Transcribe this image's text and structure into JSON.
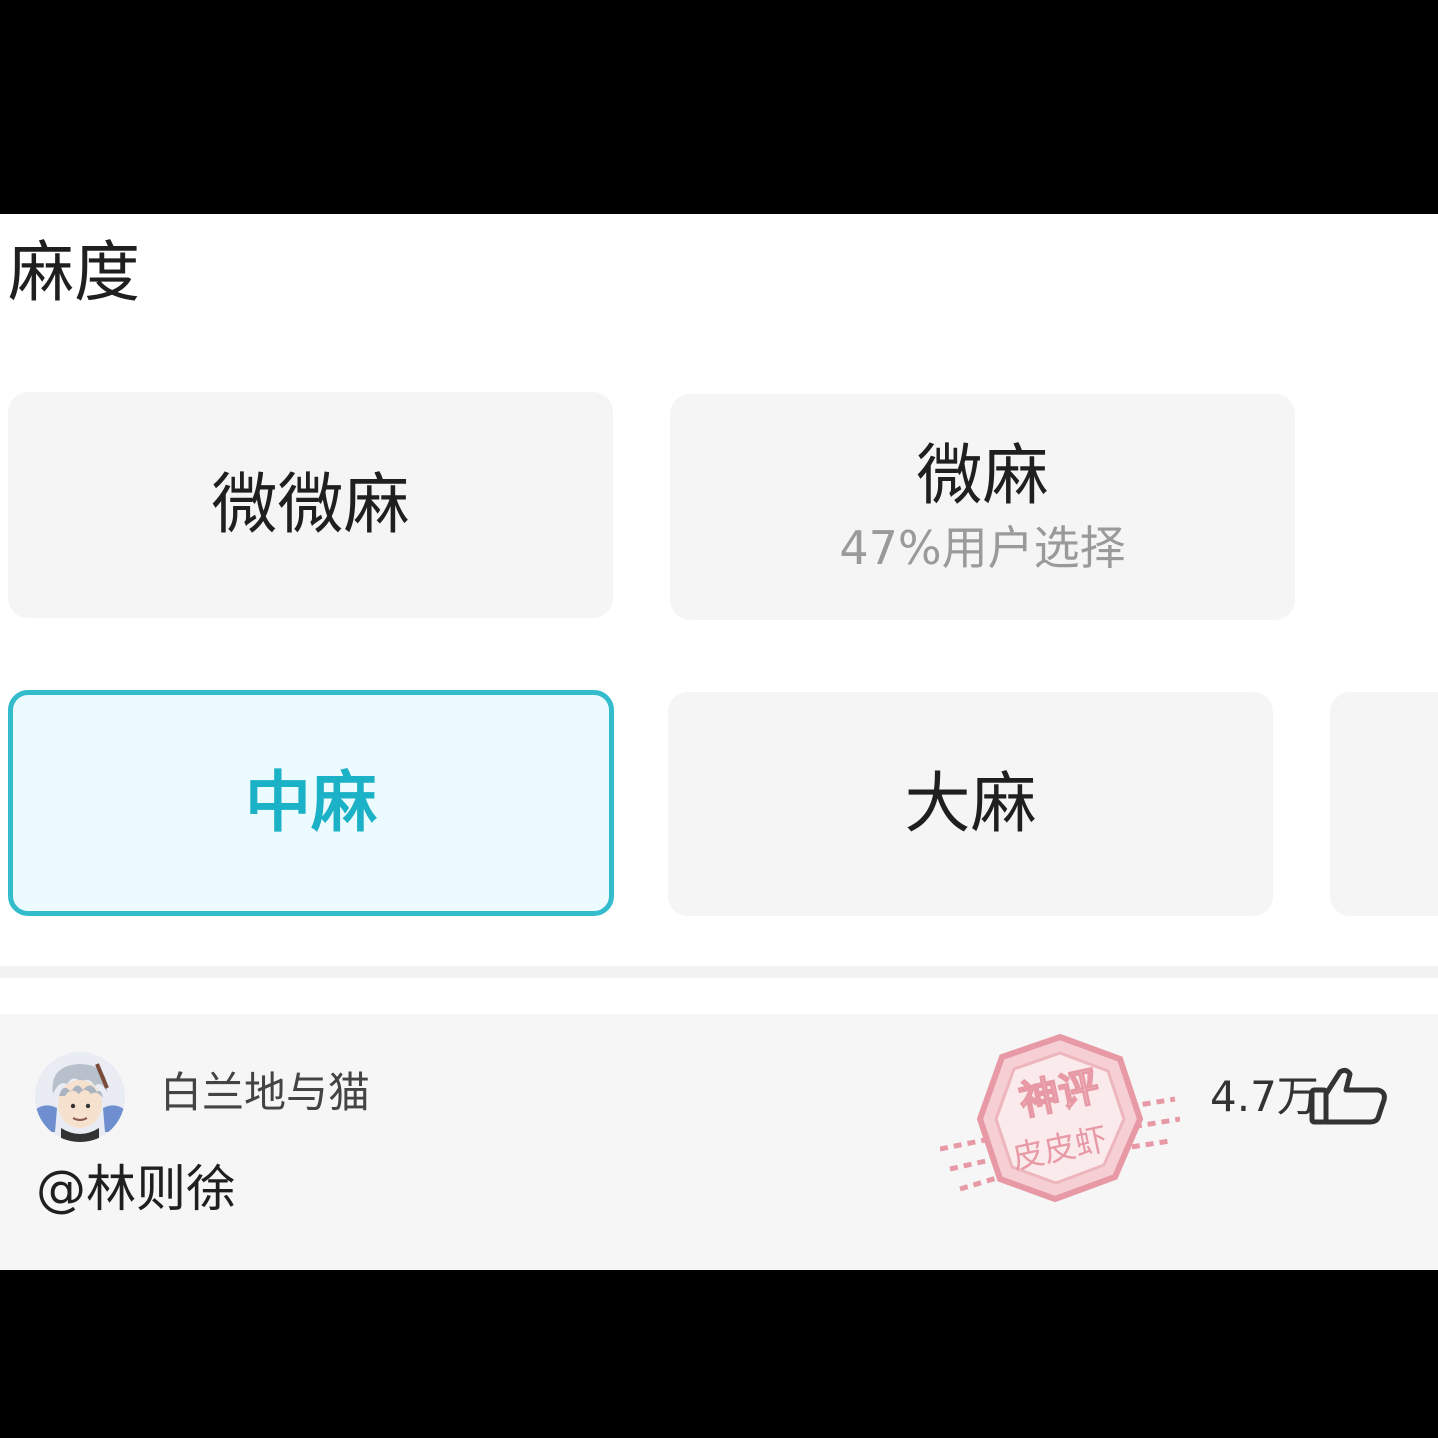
{
  "section": {
    "title": "麻度"
  },
  "options": [
    {
      "label": "微微麻",
      "sub": ""
    },
    {
      "label": "微麻",
      "sub": "47%用户选择"
    },
    {
      "label": "中麻",
      "sub": ""
    },
    {
      "label": "大麻",
      "sub": ""
    }
  ],
  "selected_option": "中麻",
  "comment": {
    "username": "白兰地与猫",
    "text": "@林则徐",
    "likes": "4.7万"
  },
  "watermark": {
    "top": "神评",
    "bottom": "皮皮虾"
  },
  "colors": {
    "accent": "#1bb1c6",
    "accent_border": "#33bccb",
    "option_bg": "#f5f5f5",
    "watermark": "#e58a97"
  },
  "icons": {
    "like": "thumbs-up-icon",
    "avatar": "avatar"
  }
}
